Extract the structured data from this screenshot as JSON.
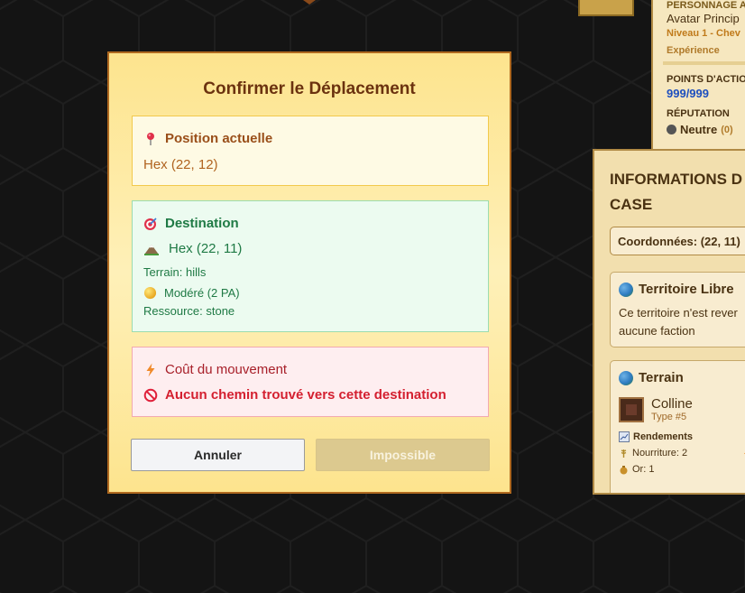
{
  "modal": {
    "title": "Confirmer le Déplacement",
    "current": {
      "heading": "Position actuelle",
      "value": "Hex (22, 12)"
    },
    "destination": {
      "heading": "Destination",
      "value": "Hex (22, 11)",
      "terrain": "Terrain: hills",
      "difficulty": "Modéré (2 PA)",
      "resource": "Ressource: stone"
    },
    "cost": {
      "heading": "Coût du mouvement",
      "error": "Aucun chemin trouvé vers cette destination"
    },
    "buttons": {
      "cancel": "Annuler",
      "confirm": "Impossible"
    }
  },
  "character_panel": {
    "header": "PERSONNAGE A",
    "name": "Avatar Princip",
    "level": "Niveau 1 - Chev",
    "experience_label": "Expérience",
    "action_points_label": "POINTS D'ACTIO",
    "action_points_value": "999/999",
    "reputation_label": "RÉPUTATION",
    "reputation_value": "Neutre",
    "reputation_count": "(0)"
  },
  "tile_panel": {
    "title": "INFORMATIONS D CASE",
    "coordinates": "Coordonnées: (22, 11)",
    "territory": {
      "heading": "Territoire Libre",
      "description": "Ce territoire n'est rever aucune faction"
    },
    "terrain": {
      "heading": "Terrain",
      "name": "Colline",
      "type": "Type #5",
      "yields_label": "Rendements",
      "food": "Nourriture: 2",
      "gold": "Or: 1"
    }
  },
  "colors": {
    "modal_border": "#b0691f",
    "title": "#6b320f",
    "current_text": "#9a4f1a",
    "destination_text": "#1f7a45",
    "cost_text": "#a8202a",
    "error_text": "#d42030"
  },
  "icons": {
    "current": "pushpin-icon",
    "destination": "target-icon",
    "terrain": "mountain-icon",
    "difficulty": "yellow-circle-icon",
    "cost": "lightning-icon",
    "error": "prohibited-icon"
  }
}
